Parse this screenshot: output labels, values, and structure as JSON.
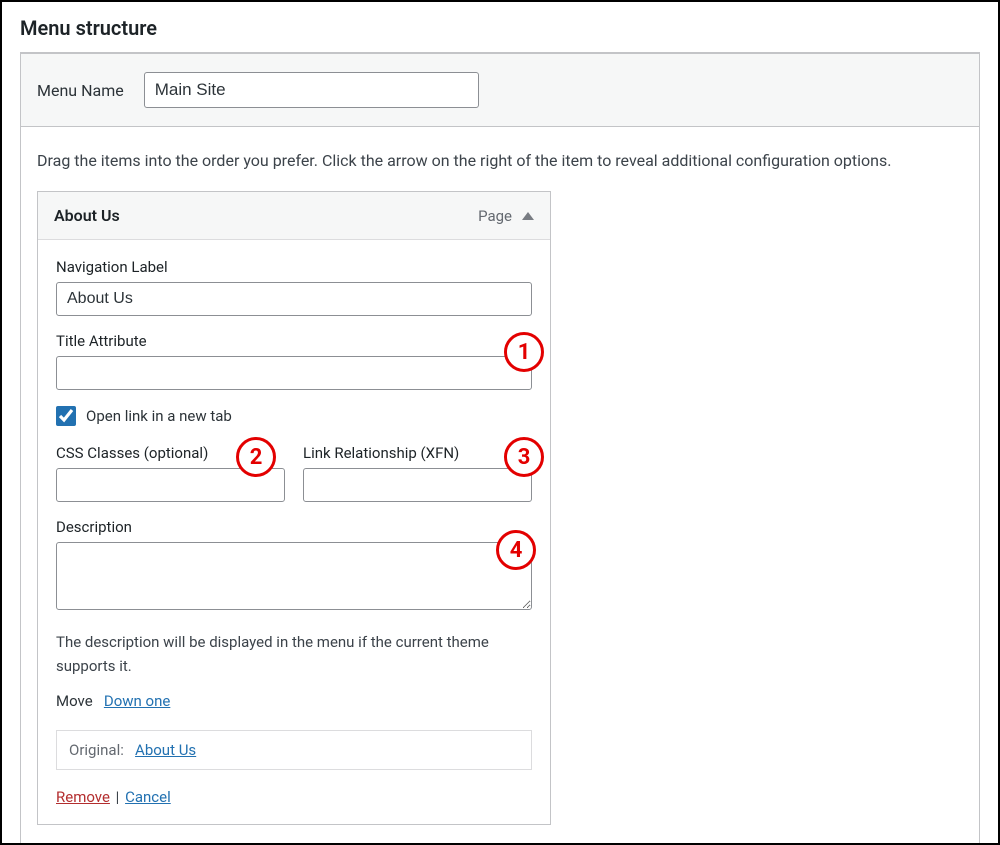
{
  "panel_title": "Menu structure",
  "menu_name": {
    "label": "Menu Name",
    "value": "Main Site"
  },
  "instructions": "Drag the items into the order you prefer. Click the arrow on the right of the item to reveal additional configuration options.",
  "item": {
    "title": "About Us",
    "type": "Page",
    "fields": {
      "nav_label": {
        "label": "Navigation Label",
        "value": "About Us"
      },
      "title_attr": {
        "label": "Title Attribute",
        "value": ""
      },
      "open_new_tab": {
        "label": "Open link in a new tab",
        "checked": true
      },
      "css_classes": {
        "label": "CSS Classes (optional)",
        "value": ""
      },
      "xfn": {
        "label": "Link Relationship (XFN)",
        "value": ""
      },
      "description": {
        "label": "Description",
        "value": ""
      }
    },
    "desc_hint": "The description will be displayed in the menu if the current theme supports it.",
    "move": {
      "label": "Move",
      "down_one": "Down one"
    },
    "original": {
      "label": "Original:",
      "link": "About Us"
    },
    "actions": {
      "remove": "Remove",
      "cancel": "Cancel",
      "sep": "|"
    }
  },
  "callouts": {
    "one": "1",
    "two": "2",
    "three": "3",
    "four": "4"
  }
}
